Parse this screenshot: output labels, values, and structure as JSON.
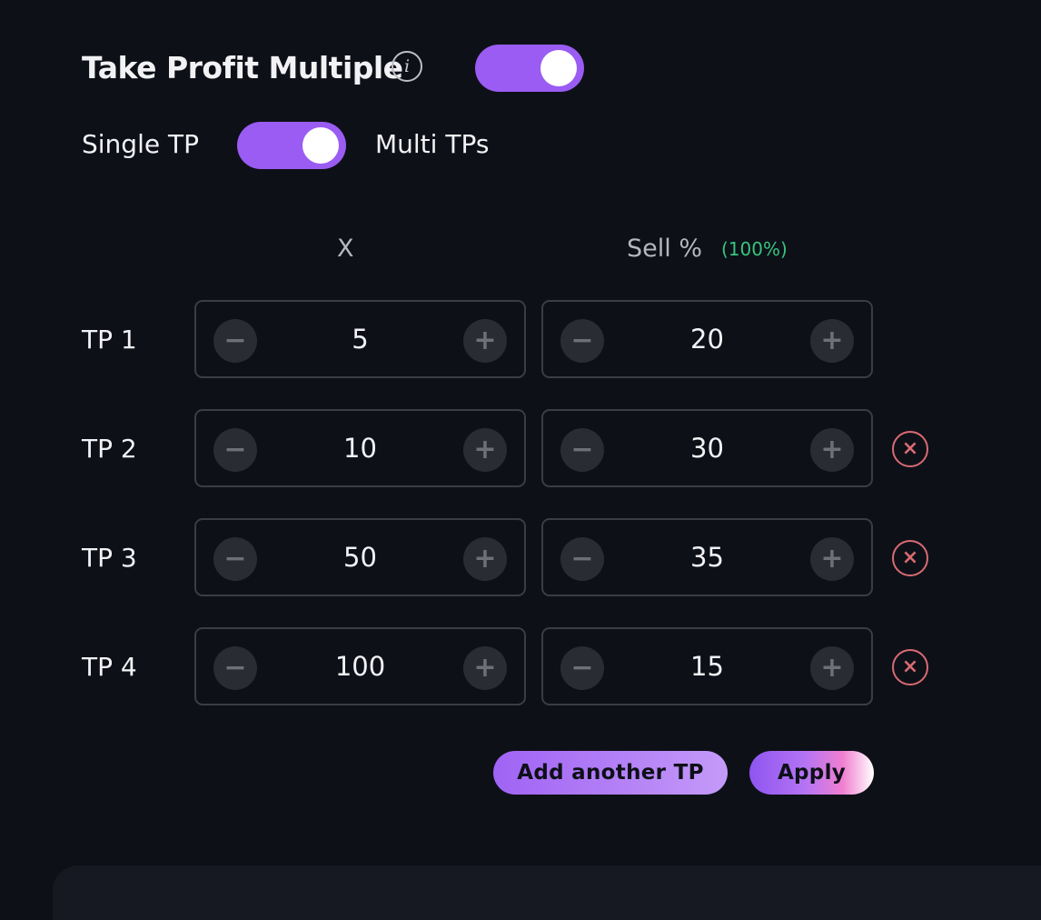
{
  "header": {
    "title": "Take Profit Multiple",
    "enabled": true
  },
  "mode": {
    "left_label": "Single TP",
    "right_label": "Multi TPs",
    "selected": "Multi TPs"
  },
  "columns": {
    "x_label": "X",
    "sell_label": "Sell %",
    "sell_total": "(100%)"
  },
  "rows": [
    {
      "label": "TP 1",
      "x": "5",
      "sell": "20",
      "removable": false
    },
    {
      "label": "TP 2",
      "x": "10",
      "sell": "30",
      "removable": true
    },
    {
      "label": "TP 3",
      "x": "50",
      "sell": "35",
      "removable": true
    },
    {
      "label": "TP 4",
      "x": "100",
      "sell": "15",
      "removable": true
    }
  ],
  "actions": {
    "add_label": "Add another TP",
    "apply_label": "Apply"
  },
  "icons": {
    "info": "info-icon",
    "minus": "minus-icon",
    "plus": "plus-icon",
    "remove": "remove-icon"
  },
  "colors": {
    "background": "#0e1018",
    "accent": "#9a5cf2",
    "total_green": "#36c47e",
    "remove_red": "#d96b73"
  }
}
